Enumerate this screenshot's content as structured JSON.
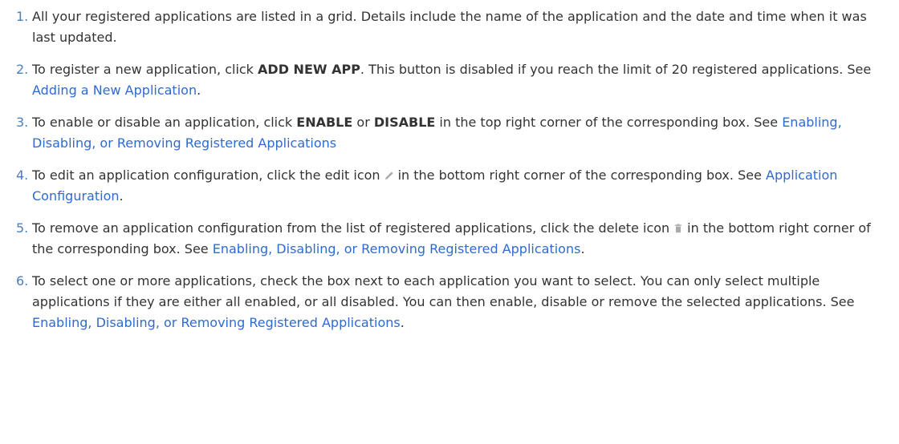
{
  "steps": [
    {
      "num": "1.",
      "text": "All your registered applications are listed in a grid. Details include the name of the application and the date and time when it was last updated."
    },
    {
      "num": "2.",
      "t1": "To register a new application, click ",
      "b1": "ADD NEW APP",
      "t2": ". This button is disabled if you reach the limit of 20 registered applications. See ",
      "link": "Adding a New Application",
      "t3": "."
    },
    {
      "num": "3.",
      "t1": "To enable or disable an application, click ",
      "b1": "ENABLE",
      "t2": " or ",
      "b2": "DISABLE",
      "t3": " in the top right corner of the corresponding box. See ",
      "link": "Enabling, Disabling, or Removing Registered Applications"
    },
    {
      "num": "4.",
      "t1": "To edit an application configuration, click the edit icon",
      "icon": "pencil-icon",
      "t2": "in the bottom right corner of the corresponding box. See ",
      "link": "Application Configuration",
      "t3": "."
    },
    {
      "num": "5.",
      "t1": "To remove an application configuration from the list of registered applications, click the delete icon",
      "icon": "trash-icon",
      "t2": "in the bottom right corner of the corresponding box. See ",
      "link": "Enabling, Disabling, or Removing Registered Applications",
      "t3": "."
    },
    {
      "num": "6.",
      "t1": "To select one or more applications, check the box next to each application you want to select. You can only select multiple applications if they are either all enabled, or all disabled. You can then enable, disable or remove the selected applications. See ",
      "link": "Enabling, Disabling, or Removing Registered Applications",
      "t3": "."
    }
  ],
  "colors": {
    "text": "#333333",
    "number": "#4a7fc1",
    "link": "#2e6bd1",
    "icon": "#aaaaaa"
  }
}
